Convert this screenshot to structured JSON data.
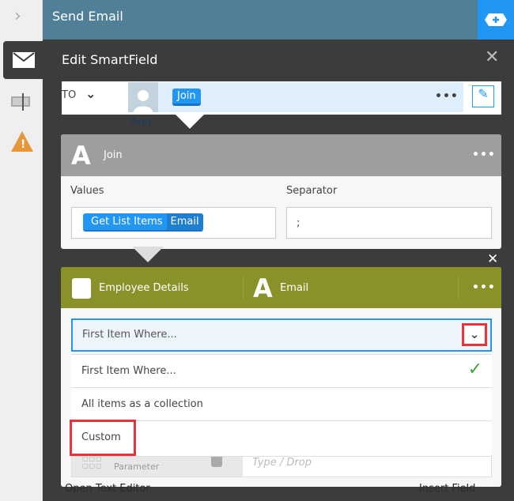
{
  "header": {
    "title": "Send Email",
    "add_icon": "add-badge-icon"
  },
  "sidebar": {
    "icons": [
      "chevron-right-icon",
      "mail-icon",
      "text-field-icon",
      "warning-icon"
    ]
  },
  "dialog": {
    "title": "Edit SmartField",
    "close": "✕"
  },
  "to_row": {
    "label": "TO",
    "chip": "Join",
    "add": "Add",
    "more": "•••"
  },
  "join_card": {
    "title": "Join",
    "more": "•••",
    "values_label": "Values",
    "separator_label": "Separator",
    "values_chip": {
      "source": "Get List Items",
      "field": "Email"
    },
    "separator_value": ";"
  },
  "details_card": {
    "close": "✕",
    "source": "Employee Details",
    "field": "Email",
    "more": "•••",
    "color": "#8a9128"
  },
  "dropdown": {
    "selected": "First Item Where...",
    "options": [
      {
        "label": "First Item Where...",
        "checked": true
      },
      {
        "label": "All items as a collection",
        "checked": false
      },
      {
        "label": "Custom",
        "checked": false
      }
    ]
  },
  "hidden_row": {
    "sub": "Parameter",
    "placeholder": "Type / Drop"
  },
  "footer": {
    "left": "Open Text Editor",
    "right": "Insert Field"
  }
}
